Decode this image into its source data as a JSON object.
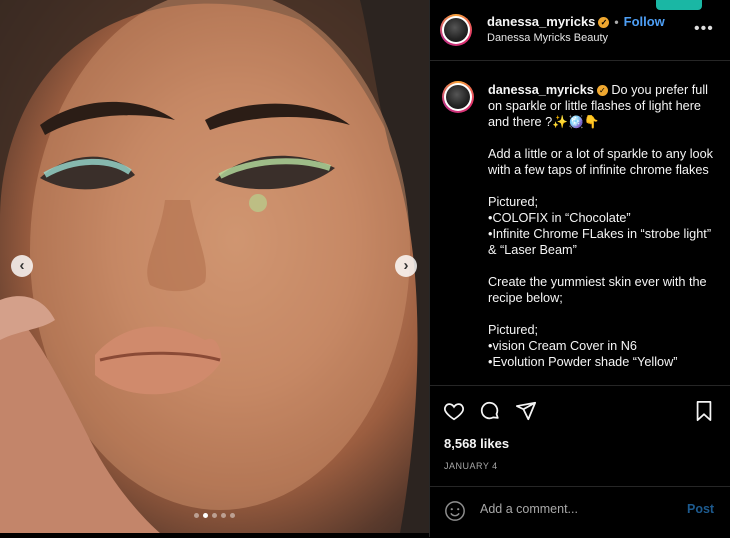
{
  "post": {
    "username": "danessa_myricks",
    "follow_label": "Follow",
    "separator": "•",
    "subtitle": "Danessa Myricks Beauty",
    "more_label": "•••"
  },
  "caption": {
    "username": "danessa_myricks",
    "line1": "Do you prefer full on sparkle or little flashes of light here and there ?✨🪩👇",
    "p2": "Add a little or a lot of sparkle to any look with a few taps of infinite chrome flakes",
    "p3": "Pictured;\n•COLOFIX in “Chocolate”\n•Infinite Chrome FLakes in “strobe light” & “Laser Beam”",
    "p4": "Create the yummiest skin ever with the recipe below;",
    "p5": "Pictured;\n•vision Cream Cover in N6\n•Evolution Powder shade “Yellow”"
  },
  "stats": {
    "likes": "8,568 likes",
    "date": "JANUARY 4"
  },
  "comment": {
    "placeholder": "Add a comment...",
    "post_label": "Post"
  },
  "carousel": {
    "prev_icon": "‹",
    "next_icon": "›",
    "slide_count": 5,
    "active_index": 1
  },
  "icons": [
    "heart-icon",
    "comment-icon",
    "share-icon",
    "bookmark-icon",
    "emoji-icon",
    "verified-badge-icon",
    "more-options-icon"
  ],
  "colors": {
    "accent_blue": "#4e9ff5",
    "verified": "#f0a830",
    "background": "#000000"
  }
}
